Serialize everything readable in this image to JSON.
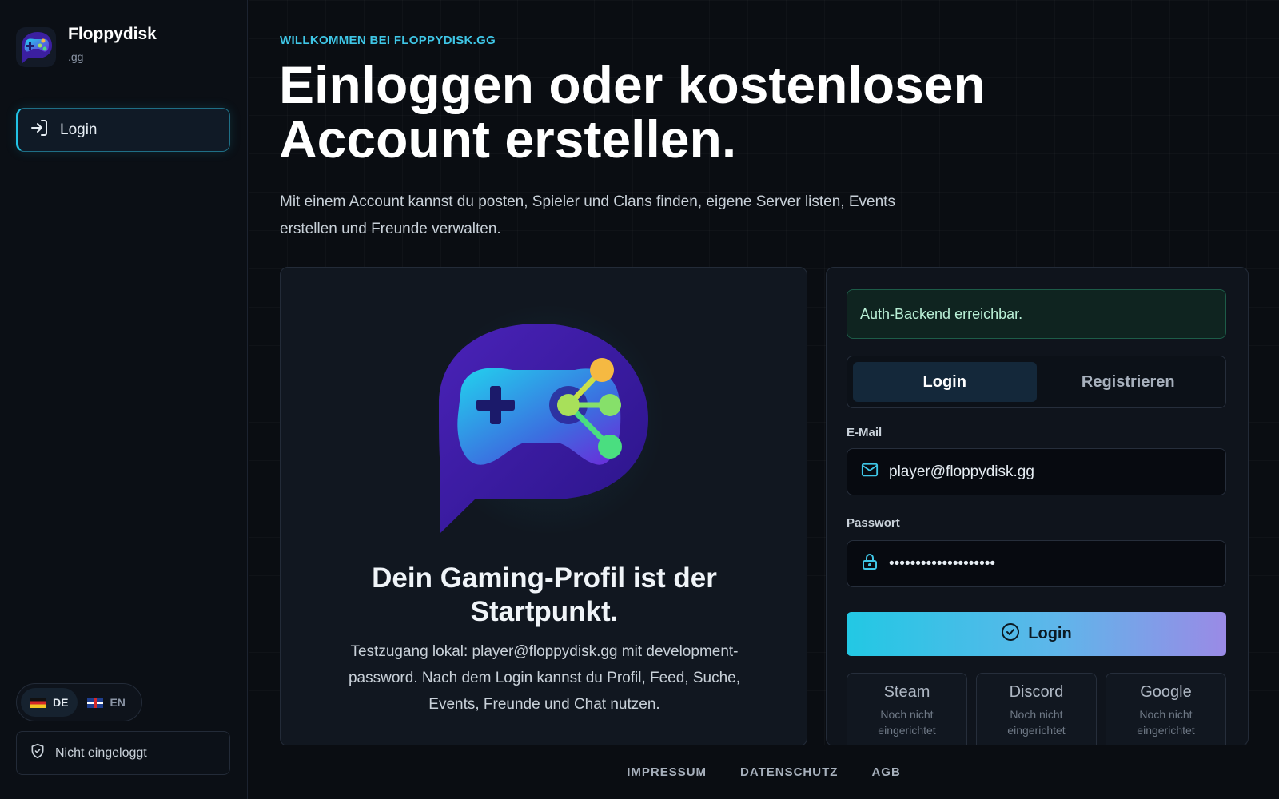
{
  "brand": {
    "name": "Floppydisk",
    "suffix": ".gg"
  },
  "sidebar": {
    "nav": [
      {
        "label": "Login",
        "icon": "login-icon",
        "active": true
      }
    ],
    "languages": [
      {
        "code": "DE",
        "active": true
      },
      {
        "code": "EN",
        "active": false
      }
    ],
    "status": {
      "icon": "shield-check-icon",
      "label": "Nicht eingeloggt"
    }
  },
  "main": {
    "eyebrow": "WILLKOMMEN BEI FLOPPYDISK.GG",
    "headline_line1": "Einloggen oder kostenlosen",
    "headline_line2": "Account erstellen.",
    "intro": "Mit einem Account kannst du posten, Spieler und Clans finden, eigene Server listen, Events erstellen und Freunde verwalten."
  },
  "hero": {
    "title": "Dein Gaming-Profil ist der Startpunkt.",
    "description": "Testzugang lokal: player@floppydisk.gg mit development-password. Nach dem Login kannst du Profil, Feed, Suche, Events, Freunde und Chat nutzen."
  },
  "auth": {
    "alert": "Auth-Backend erreichbar.",
    "tabs": [
      {
        "label": "Login",
        "active": true
      },
      {
        "label": "Registrieren",
        "active": false
      }
    ],
    "email_label": "E-Mail",
    "email_value": "player@floppydisk.gg",
    "password_label": "Passwort",
    "password_value": "••••••••••••••••••••",
    "submit_label": "Login",
    "providers": [
      {
        "name": "Steam",
        "state": "Noch nicht eingerichtet"
      },
      {
        "name": "Discord",
        "state": "Noch nicht eingerichtet"
      },
      {
        "name": "Google",
        "state": "Noch nicht eingerichtet"
      }
    ]
  },
  "footer": {
    "links": [
      "IMPRESSUM",
      "DATENSCHUTZ",
      "AGB"
    ]
  },
  "colors": {
    "accent": "#22c3e6",
    "background": "#0a0d12",
    "success": "#b9f0d6"
  }
}
